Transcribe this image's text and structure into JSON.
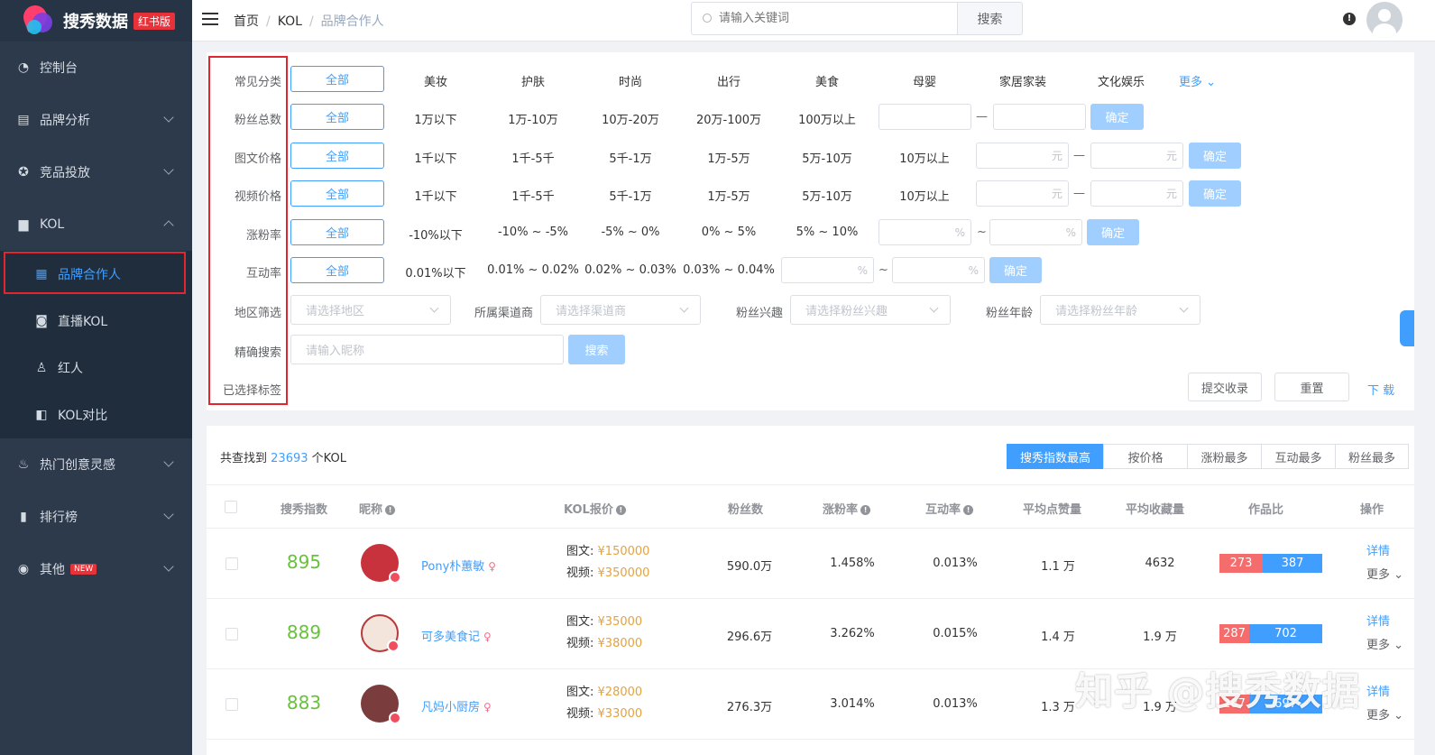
{
  "brand": {
    "name": "搜秀数据",
    "badge": "红书版"
  },
  "sidebar": {
    "items": [
      {
        "label": "控制台",
        "icon": "dashboard-icon"
      },
      {
        "label": "品牌分析",
        "icon": "chart-icon"
      },
      {
        "label": "竞品投放",
        "icon": "target-icon"
      },
      {
        "label": "KOL",
        "icon": "bookmark-icon"
      },
      {
        "label": "热门创意灵感",
        "icon": "fire-icon"
      },
      {
        "label": "排行榜",
        "icon": "bar-chart-icon"
      },
      {
        "label": "其他",
        "icon": "circle-icon",
        "badge": "NEW"
      }
    ],
    "sub_items": [
      {
        "label": "品牌合作人",
        "icon": "grid-icon",
        "active": true
      },
      {
        "label": "直播KOL",
        "icon": "camera-icon"
      },
      {
        "label": "红人",
        "icon": "user-icon"
      },
      {
        "label": "KOL对比",
        "icon": "compare-icon"
      }
    ]
  },
  "header": {
    "breadcrumb": [
      "首页",
      "KOL",
      "品牌合作人"
    ],
    "search_placeholder": "请输入关键词",
    "search_button": "搜索"
  },
  "filters": {
    "all_label": "全部",
    "confirm_label": "确定",
    "category": {
      "label": "常见分类",
      "options": [
        "美妆",
        "护肤",
        "时尚",
        "出行",
        "美食",
        "母婴",
        "家居家装",
        "文化娱乐"
      ],
      "more": "更多"
    },
    "fans": {
      "label": "粉丝总数",
      "options": [
        "1万以下",
        "1万-10万",
        "10万-20万",
        "20万-100万",
        "100万以上"
      ]
    },
    "image_price": {
      "label": "图文价格",
      "options": [
        "1千以下",
        "1千-5千",
        "5千-1万",
        "1万-5万",
        "5万-10万",
        "10万以上"
      ],
      "unit": "元"
    },
    "video_price": {
      "label": "视频价格",
      "options": [
        "1千以下",
        "1千-5千",
        "5千-1万",
        "1万-5万",
        "5万-10万",
        "10万以上"
      ],
      "unit": "元"
    },
    "growth": {
      "label": "涨粉率",
      "options": [
        "-10%以下",
        "-10% ~ -5%",
        "-5% ~ 0%",
        "0% ~ 5%",
        "5% ~ 10%"
      ],
      "unit": "%",
      "sep": "~"
    },
    "engagement": {
      "label": "互动率",
      "options": [
        "0.01%以下",
        "0.01% ~ 0.02%",
        "0.02% ~ 0.03%",
        "0.03% ~ 0.04%"
      ],
      "unit": "%",
      "sep": "~"
    },
    "dash": "—",
    "region": {
      "label": "地区筛选",
      "placeholder": "请选择地区"
    },
    "channel": {
      "label": "所属渠道商",
      "placeholder": "请选择渠道商"
    },
    "interest": {
      "label": "粉丝兴趣",
      "placeholder": "请选择粉丝兴趣"
    },
    "age": {
      "label": "粉丝年龄",
      "placeholder": "请选择粉丝年龄"
    },
    "exact": {
      "label": "精确搜索",
      "placeholder": "请输入昵称",
      "button": "搜索"
    },
    "selected": {
      "label": "已选择标签"
    },
    "actions": {
      "submit": "提交收录",
      "reset": "重置",
      "download": "下 载"
    }
  },
  "results": {
    "total_prefix": "共查找到",
    "total_count": "23693",
    "total_suffix": "个KOL",
    "sort_tabs": [
      "搜秀指数最高",
      "按价格",
      "涨粉最多",
      "互动最多",
      "粉丝最多"
    ],
    "columns": [
      "搜秀指数",
      "昵称",
      "KOL报价",
      "粉丝数",
      "涨粉率",
      "互动率",
      "平均点赞量",
      "平均收藏量",
      "作品比",
      "操作"
    ],
    "price_labels": {
      "image": "图文:",
      "video": "视频:"
    },
    "detail_label": "详情",
    "more_label": "更多",
    "rows": [
      {
        "score": "895",
        "nick": "Pony朴蕙敏",
        "gender": "♀",
        "image_price": "¥150000",
        "video_price": "¥350000",
        "fans": "590.0万",
        "growth": "1.458%",
        "engagement": "0.013%",
        "likes": "1.1 万",
        "collects": "4632",
        "ratio_a": "273",
        "ratio_b": "387",
        "avatar_color": "#c8323c"
      },
      {
        "score": "889",
        "nick": "可多美食记",
        "gender": "♀",
        "image_price": "¥35000",
        "video_price": "¥38000",
        "fans": "296.6万",
        "growth": "3.262%",
        "engagement": "0.015%",
        "likes": "1.4 万",
        "collects": "1.9 万",
        "ratio_a": "287",
        "ratio_b": "702",
        "avatar_color": "#f3e4dc"
      },
      {
        "score": "883",
        "nick": "凡妈小厨房",
        "gender": "♀",
        "image_price": "¥28000",
        "video_price": "¥33000",
        "fans": "276.3万",
        "growth": "3.014%",
        "engagement": "0.013%",
        "likes": "1.3 万",
        "collects": "1.9 万",
        "ratio_a": "287",
        "ratio_b": "697",
        "avatar_color": "#7a3c3c"
      }
    ]
  },
  "watermark": "知乎 @搜秀数据"
}
